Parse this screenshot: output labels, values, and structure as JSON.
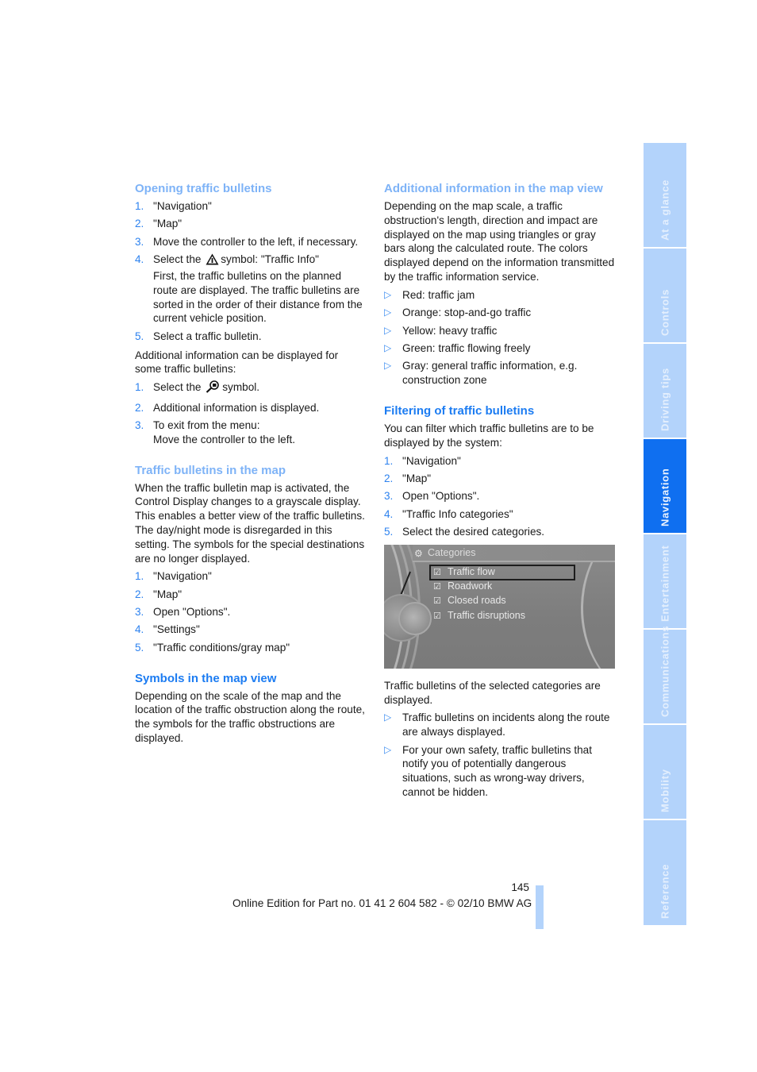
{
  "left_column": {
    "opening": {
      "heading": "Opening traffic bulletins",
      "steps": [
        {
          "num": "1.",
          "text": "\"Navigation\""
        },
        {
          "num": "2.",
          "text": "\"Map\""
        },
        {
          "num": "3.",
          "text": "Move the controller to the left, if necessary."
        },
        {
          "num": "4.",
          "text_before": "Select the",
          "icon": "warning-triangle-icon",
          "text_after": "symbol: \"Traffic Info\"",
          "detail": "First, the traffic bulletins on the planned route are displayed. The traffic bulletins are sorted in the order of their distance from the current vehicle position."
        },
        {
          "num": "5.",
          "text": "Select a traffic bulletin."
        }
      ],
      "additional_intro": "Additional information can be displayed for some traffic bulletins:",
      "additional_steps": [
        {
          "num": "1.",
          "text_before": "Select the",
          "icon": "magnifier-info-icon",
          "text_after": "symbol."
        },
        {
          "num": "2.",
          "text": "Additional information is displayed."
        },
        {
          "num": "3.",
          "text": "To exit from the menu:",
          "detail": "Move the controller to the left."
        }
      ]
    },
    "map": {
      "heading": "Traffic bulletins in the map",
      "body": "When the traffic bulletin map is activated, the Control Display changes to a grayscale display. This enables a better view of the traffic bulletins. The day/night mode is disregarded in this setting. The symbols for the special destinations are no longer displayed.",
      "steps": [
        {
          "num": "1.",
          "text": "\"Navigation\""
        },
        {
          "num": "2.",
          "text": "\"Map\""
        },
        {
          "num": "3.",
          "text": "Open \"Options\"."
        },
        {
          "num": "4.",
          "text": "\"Settings\""
        },
        {
          "num": "5.",
          "text": "\"Traffic conditions/gray map\""
        }
      ]
    },
    "symbols": {
      "heading": "Symbols in the map view",
      "body": "Depending on the scale of the map and the location of the traffic obstruction along the route, the symbols for the traffic obstructions are displayed."
    }
  },
  "right_column": {
    "additional": {
      "heading": "Additional information in the map view",
      "body": "Depending on the map scale, a traffic obstruction's length, direction and impact are displayed on the map using triangles or gray bars along the calculated route. The colors displayed depend on the information transmitted by the traffic information service.",
      "bullets": [
        "Red: traffic jam",
        "Orange: stop-and-go traffic",
        "Yellow: heavy traffic",
        "Green: traffic flowing freely",
        "Gray: general traffic information, e.g. construction zone"
      ]
    },
    "filtering": {
      "heading": "Filtering of traffic bulletins",
      "body": "You can filter which traffic bulletins are to be displayed by the system:",
      "steps": [
        {
          "num": "1.",
          "text": "\"Navigation\""
        },
        {
          "num": "2.",
          "text": "\"Map\""
        },
        {
          "num": "3.",
          "text": "Open \"Options\"."
        },
        {
          "num": "4.",
          "text": "\"Traffic Info categories\""
        },
        {
          "num": "5.",
          "text": "Select the desired categories."
        }
      ],
      "screen": {
        "title": "Categories",
        "items": [
          {
            "label": "Traffic flow",
            "checked": true,
            "selected": true
          },
          {
            "label": "Roadwork",
            "checked": true,
            "selected": false
          },
          {
            "label": "Closed roads",
            "checked": true,
            "selected": false
          },
          {
            "label": "Traffic disruptions",
            "checked": true,
            "selected": false
          }
        ]
      },
      "after_screen": "Traffic bulletins of the selected categories are displayed.",
      "bullets": [
        "Traffic bulletins on incidents along the route are always displayed.",
        "For your own safety, traffic bulletins that notify you of potentially dangerous situations, such as wrong-way drivers, cannot be hidden."
      ]
    }
  },
  "side_tabs": [
    {
      "label": "At a glance",
      "active": false
    },
    {
      "label": "Controls",
      "active": false
    },
    {
      "label": "Driving tips",
      "active": false
    },
    {
      "label": "Navigation",
      "active": true
    },
    {
      "label": "Entertainment",
      "active": false
    },
    {
      "label": "Communications",
      "active": false
    },
    {
      "label": "Mobility",
      "active": false
    },
    {
      "label": "Reference",
      "active": false
    }
  ],
  "footer": {
    "page_number": "145",
    "edition": "Online Edition for Part no. 01 41 2 604 582 - © 02/10 BMW AG"
  },
  "colors": {
    "heading_light": "#7eb3f7",
    "heading_strong": "#1c7cf2",
    "tab_inactive": "#b3d3fb",
    "tab_active": "#0f6ff0"
  }
}
